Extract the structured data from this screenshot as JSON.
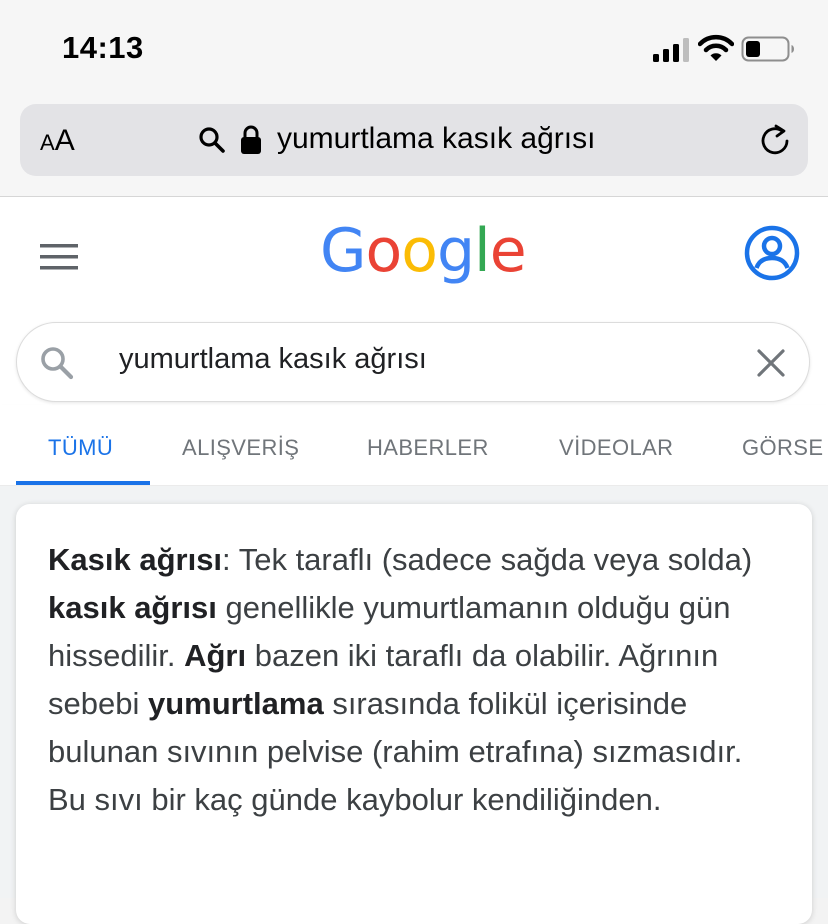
{
  "status_bar": {
    "time": "14:13"
  },
  "browser": {
    "text_size_small": "A",
    "text_size_large": "A",
    "url": "yumurtlama kasık ağrısı"
  },
  "google": {
    "logo": {
      "letters": [
        "G",
        "o",
        "o",
        "g",
        "l",
        "e"
      ],
      "colors": [
        "#4285F4",
        "#EA4335",
        "#FBBC05",
        "#4285F4",
        "#34A853",
        "#EA4335"
      ]
    },
    "search_query": "yumurtlama kasık ağrısı",
    "tabs": [
      "TÜMÜ",
      "ALIŞVERİŞ",
      "HABERLER",
      "VİDEOLAR",
      "GÖRSE"
    ],
    "active_tab": "TÜMÜ",
    "accent_color": "#1a73e8"
  },
  "snippet": {
    "segments": [
      {
        "text": "Kasık ağrısı",
        "bold": true
      },
      {
        "text": ": Tek taraflı (sadece sağda veya solda) ",
        "bold": false
      },
      {
        "text": "kasık ağrısı",
        "bold": true
      },
      {
        "text": " genellikle yumurtlamanın olduğu gün hissedilir. ",
        "bold": false
      },
      {
        "text": "Ağrı",
        "bold": true
      },
      {
        "text": " bazen iki taraflı da olabilir. Ağrının sebebi ",
        "bold": false
      },
      {
        "text": "yumurtlama",
        "bold": true
      },
      {
        "text": " sırasında folikül içerisinde bulunan sıvının pelvise (rahim etrafına) sızmasıdır. Bu sıvı bir kaç günde kaybolur kendiliğinden.",
        "bold": false
      }
    ]
  }
}
